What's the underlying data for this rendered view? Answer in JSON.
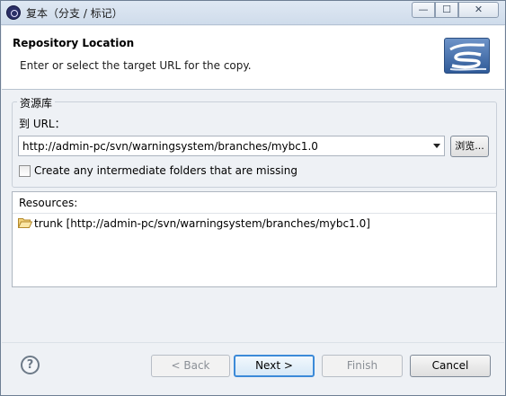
{
  "window": {
    "title": "复本（分支 / 标记）",
    "controls": {
      "minimize": "—",
      "maximize": "☐",
      "close": "✕"
    }
  },
  "header": {
    "title": "Repository Location",
    "description": "Enter or select the target URL for the copy.",
    "logo_icon": "subversion-wizard-banner-icon"
  },
  "repository_group": {
    "legend": "资源库",
    "url_label": "到 URL：",
    "url_value": "http://admin-pc/svn/warningsystem/branches/mybc1.0",
    "browse_label": "浏览...",
    "create_folders_label": "Create any intermediate folders that are missing",
    "create_folders_checked": false
  },
  "resources": {
    "label": "Resources:",
    "items": [
      {
        "label": "trunk [http://admin-pc/svn/warningsystem/branches/mybc1.0]",
        "icon": "folder-open-icon"
      }
    ]
  },
  "footer": {
    "help_glyph": "?",
    "back_label": "< Back",
    "next_label": "Next >",
    "finish_label": "Finish",
    "cancel_label": "Cancel",
    "back_enabled": false,
    "finish_enabled": false
  }
}
